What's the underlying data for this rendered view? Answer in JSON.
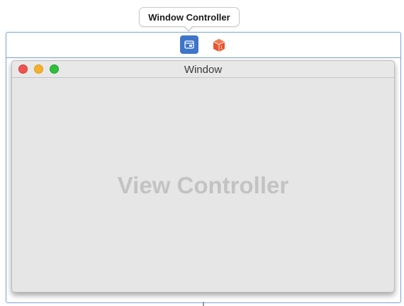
{
  "tooltip": {
    "text": "Window Controller"
  },
  "scene": {
    "dock_icons": [
      "window-controller-icon",
      "first-responder-icon"
    ]
  },
  "window": {
    "title": "Window",
    "content_label": "View Controller"
  },
  "colors": {
    "selection": "#3d75c9",
    "scene_border": "#7aa3d6",
    "close": "#f0524e",
    "minimize": "#f6b12b",
    "zoom": "#2fbf3b",
    "first_responder": "#e8552e"
  }
}
